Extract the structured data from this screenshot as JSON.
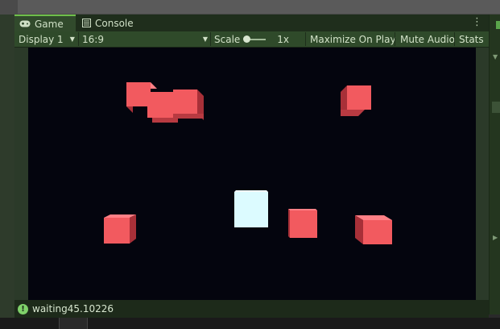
{
  "tabs": {
    "game": {
      "label": "Game",
      "icon": "gamepad-icon"
    },
    "console": {
      "label": "Console",
      "icon": "console-list-icon"
    }
  },
  "toolbar": {
    "display": "Display 1",
    "aspect": "16:9",
    "scale_label": "Scale",
    "scale_value": "1x",
    "scale_level": 0.0,
    "maximize_on_play": "Maximize On Play",
    "mute_audio": "Mute Audio",
    "stats": "Stats"
  },
  "status": {
    "message": "waiting45.10226",
    "icon": "info-icon"
  },
  "colors": {
    "viewport_bg": "#04050e",
    "cube_red": "#f25a5f",
    "cube_white": "#dcfbff",
    "accent_green": "#6fbf4a"
  }
}
